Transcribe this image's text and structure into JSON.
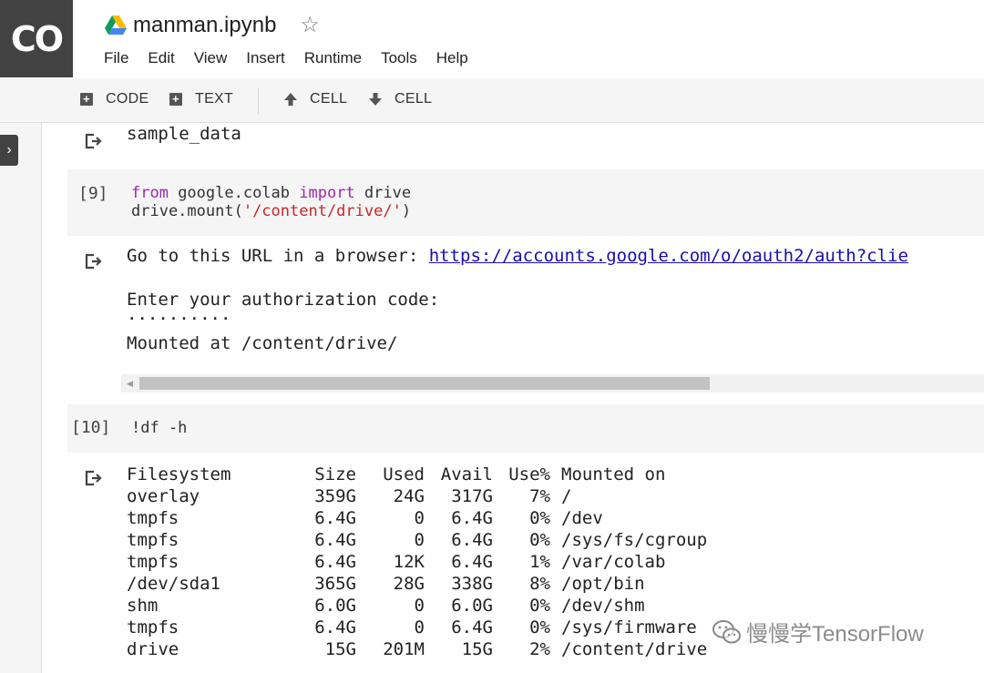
{
  "logo": {
    "text": "CO"
  },
  "header": {
    "title": "manman.ipynb"
  },
  "menu": [
    "File",
    "Edit",
    "View",
    "Insert",
    "Runtime",
    "Tools",
    "Help"
  ],
  "toolbar": {
    "code": "CODE",
    "text": "TEXT",
    "cell_up": "CELL",
    "cell_down": "CELL"
  },
  "cells": {
    "prev_output": "sample_data",
    "mount": {
      "exec_count": "[9]",
      "code": {
        "from": "from",
        "module": " google.colab ",
        "import": "import",
        "name": " drive",
        "call": "drive.mount(",
        "arg": "'/content/drive/'",
        "close": ")"
      },
      "output": {
        "url_prefix": "Go to this URL in a browser: ",
        "url": "https://accounts.google.com/o/oauth2/auth?clie",
        "prompt": "Enter your authorization code:",
        "masked": "··········",
        "mounted": "Mounted at /content/drive/"
      }
    },
    "df": {
      "exec_count": "[10]",
      "code": "!df -h",
      "headers": [
        "Filesystem",
        "Size",
        "Used",
        "Avail",
        "Use%",
        "Mounted on"
      ],
      "rows": [
        [
          "overlay",
          "359G",
          "24G",
          "317G",
          "7%",
          "/"
        ],
        [
          "tmpfs",
          "6.4G",
          "0",
          "6.4G",
          "0%",
          "/dev"
        ],
        [
          "tmpfs",
          "6.4G",
          "0",
          "6.4G",
          "0%",
          "/sys/fs/cgroup"
        ],
        [
          "tmpfs",
          "6.4G",
          "12K",
          "6.4G",
          "1%",
          "/var/colab"
        ],
        [
          "/dev/sda1",
          "365G",
          "28G",
          "338G",
          "8%",
          "/opt/bin"
        ],
        [
          "shm",
          "6.0G",
          "0",
          "6.0G",
          "0%",
          "/dev/shm"
        ],
        [
          "tmpfs",
          "6.4G",
          "0",
          "6.4G",
          "0%",
          "/sys/firmware"
        ],
        [
          "drive",
          "15G",
          "201M",
          "15G",
          "2%",
          "/content/drive"
        ]
      ]
    }
  },
  "watermark": "慢慢学TensorFlow",
  "colors": {
    "logo_bg": "#424242",
    "keyword": "#9c27b0",
    "string": "#c62828",
    "link": "#1a0dab",
    "cell_bg": "#f5f5f5"
  }
}
